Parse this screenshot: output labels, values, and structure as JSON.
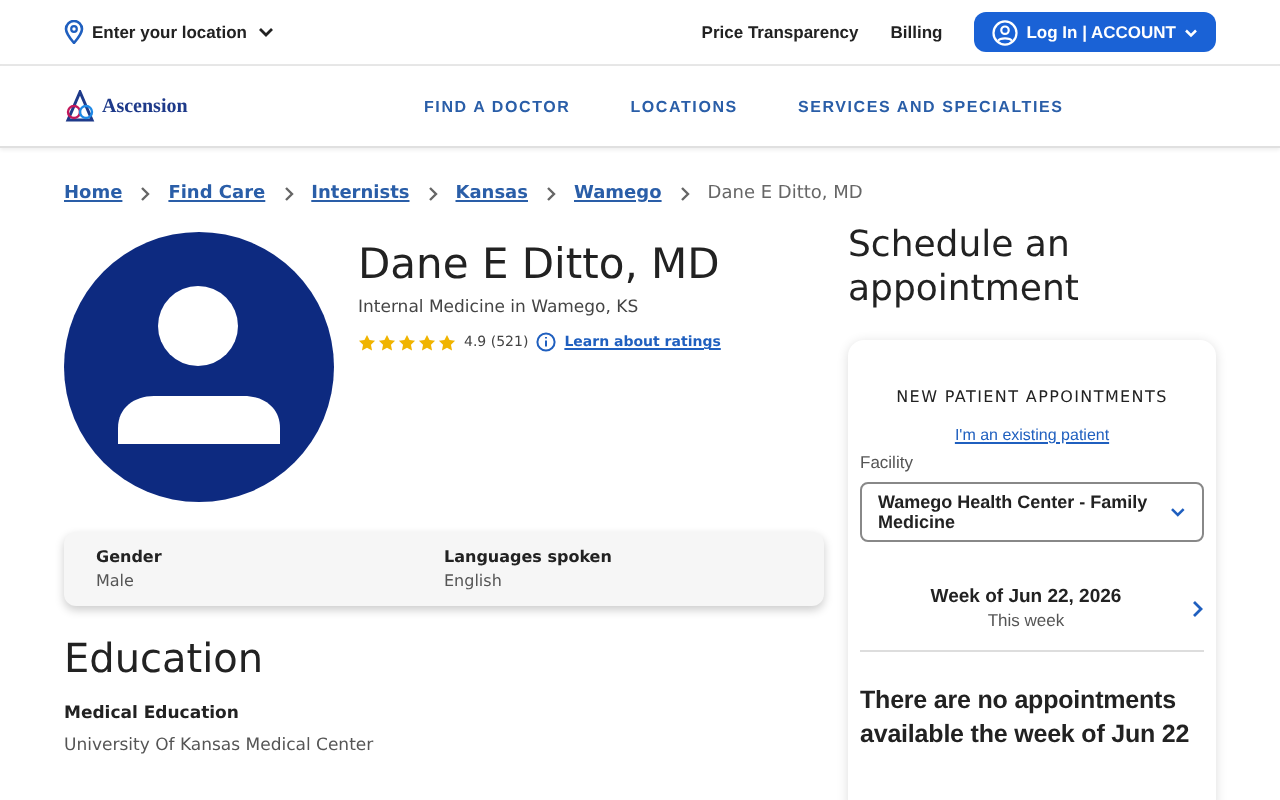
{
  "top_bar": {
    "location": "Enter your location",
    "links": [
      "Price Transparency",
      "Billing"
    ],
    "account_button": "Log In | ACCOUNT"
  },
  "nav": {
    "logo": "Ascension",
    "items": [
      "FIND A DOCTOR",
      "LOCATIONS",
      "SERVICES AND SPECIALTIES"
    ]
  },
  "breadcrumbs": [
    {
      "label": "Home",
      "kind": "link"
    },
    {
      "label": "Find Care",
      "kind": "link"
    },
    {
      "label": "Internists",
      "kind": "link"
    },
    {
      "label": "Kansas",
      "kind": "link"
    },
    {
      "label": "Wamego",
      "kind": "link"
    },
    {
      "label": "Dane E Ditto, MD",
      "kind": "current"
    }
  ],
  "profile": {
    "name": "Dane E Ditto, MD",
    "specialty": "Internal Medicine in Wamego, KS",
    "stars": 5,
    "rating": "4.9 (521)",
    "ratings_link": "Learn about ratings"
  },
  "details": [
    {
      "label": "Gender",
      "value": "Male"
    },
    {
      "label": "Languages spoken",
      "value": "English"
    }
  ],
  "education": {
    "title": "Education",
    "items": [
      {
        "label": "Medical Education",
        "value": "University Of Kansas Medical Center"
      }
    ]
  },
  "schedule": {
    "title": "Schedule an appointment",
    "heading": "NEW PATIENT APPOINTMENTS",
    "existing_link": "I'm an existing patient",
    "facility_label": "Facility",
    "facility": "Wamego Health Center - Family Medicine",
    "week": "Week of Jun 22, 2026",
    "week_note": "This week",
    "message": "There are no appointments available the week of Jun 22"
  }
}
